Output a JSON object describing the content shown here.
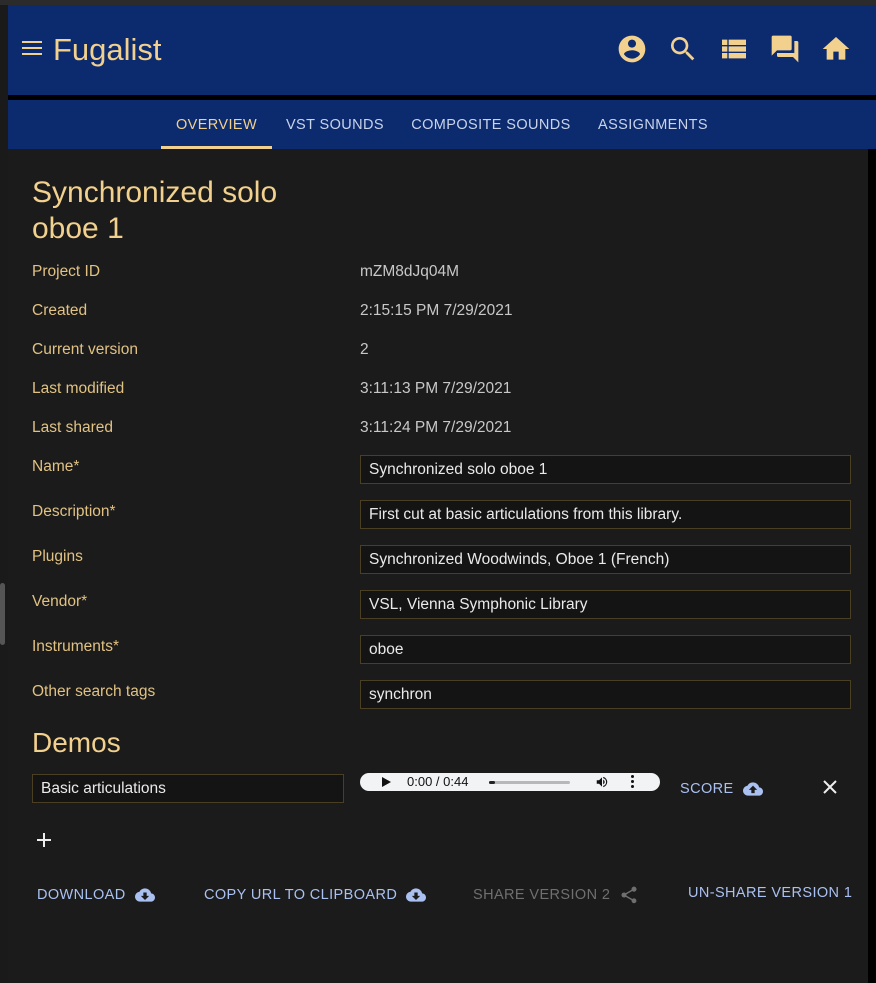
{
  "app": {
    "title": "Fugalist",
    "icons": [
      "account-icon",
      "search-icon",
      "list-icon",
      "forum-icon",
      "home-icon"
    ]
  },
  "tabs": [
    {
      "label": "OVERVIEW",
      "active": true
    },
    {
      "label": "VST SOUNDS",
      "active": false
    },
    {
      "label": "COMPOSITE SOUNDS",
      "active": false
    },
    {
      "label": "ASSIGNMENTS",
      "active": false
    }
  ],
  "project": {
    "title": "Synchronized solo oboe 1",
    "info": [
      {
        "label": "Project ID",
        "value": "mZM8dJq04M"
      },
      {
        "label": "Created",
        "value": "2:15:15 PM 7/29/2021"
      },
      {
        "label": "Current version",
        "value": "2"
      },
      {
        "label": "Last modified",
        "value": "3:11:13 PM 7/29/2021"
      },
      {
        "label": "Last shared",
        "value": "3:11:24 PM 7/29/2021"
      }
    ],
    "fields": [
      {
        "label": "Name*",
        "value": "Synchronized solo oboe 1"
      },
      {
        "label": "Description*",
        "value": "First cut at basic articulations from this library."
      },
      {
        "label": "Plugins",
        "value": "Synchronized Woodwinds, Oboe 1 (French)"
      },
      {
        "label": "Vendor*",
        "value": "VSL, Vienna Symphonic Library"
      },
      {
        "label": "Instruments*",
        "value": "oboe"
      },
      {
        "label": "Other search tags",
        "value": "synchron"
      }
    ]
  },
  "demos": {
    "heading": "Demos",
    "items": [
      {
        "name": "Basic articulations",
        "time": "0:00 / 0:44",
        "progress": 0.02,
        "score_label": "SCORE"
      }
    ]
  },
  "actions": {
    "download": "DOWNLOAD",
    "copy_url": "COPY URL TO CLIPBOARD",
    "share": "SHARE VERSION 2",
    "unshare": "UN-SHARE VERSION 1"
  },
  "colors": {
    "brand_blue": "#0c2a6e",
    "accent_gold": "#f2d08d",
    "link_blue": "#a9c0f0",
    "surface": "#1b1b1b"
  }
}
